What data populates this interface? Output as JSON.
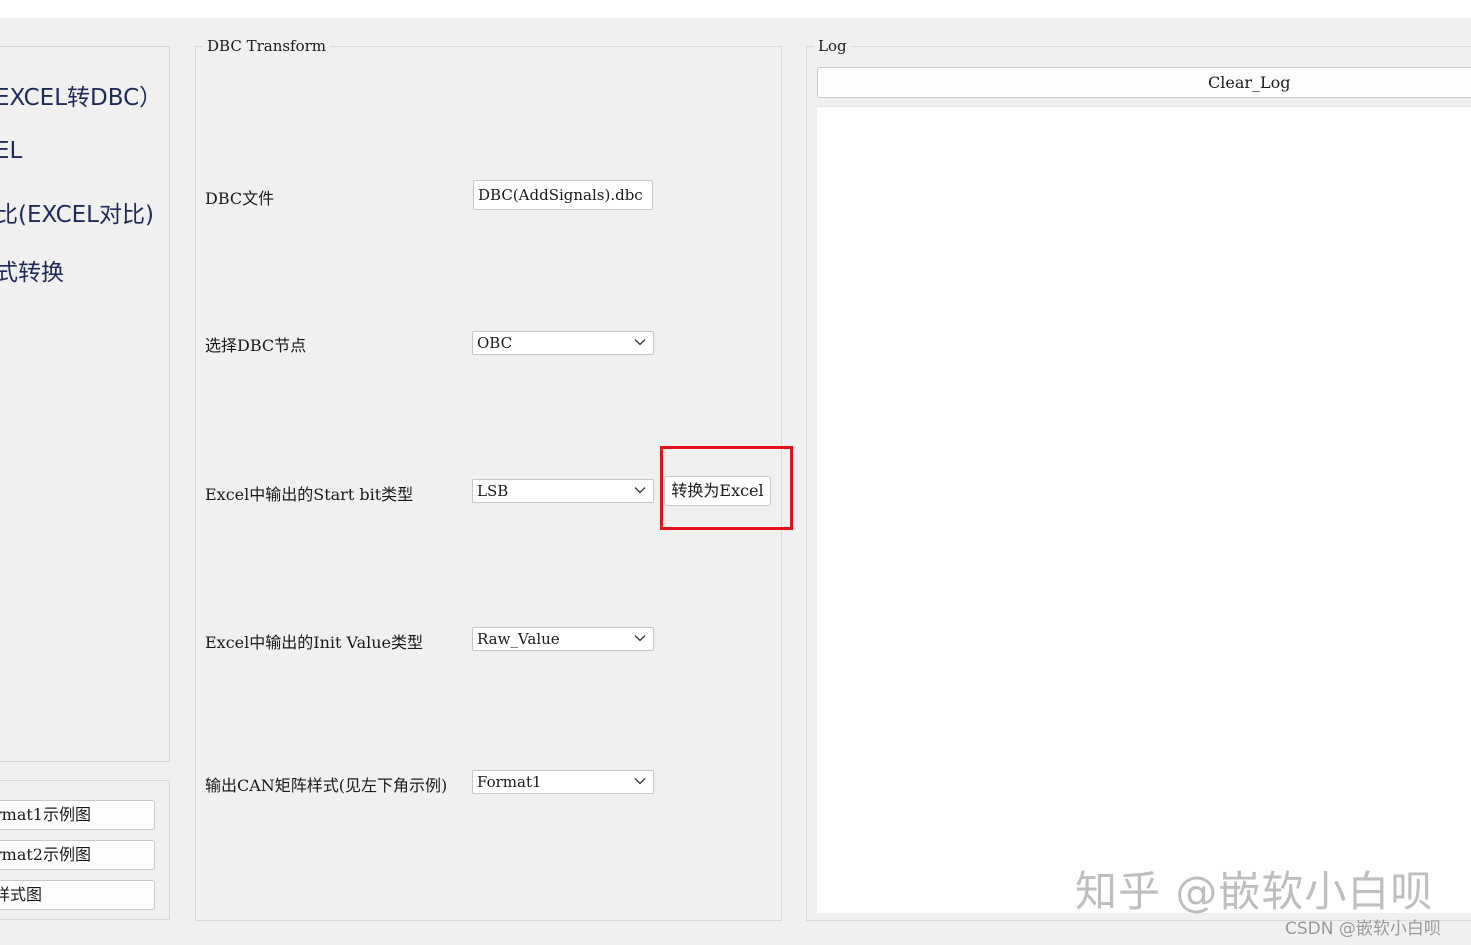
{
  "nav": {
    "items": [
      "EXCEL转DBC）",
      "EL",
      "比(EXCEL对比)",
      "式转换"
    ]
  },
  "format_buttons": [
    "rmat1示例图",
    "rmat2示例图",
    "样式图"
  ],
  "dbc_transform": {
    "title": "DBC Transform",
    "dbc_file_label": "DBC文件",
    "dbc_file_value": "DBC(AddSignals).dbc",
    "node_label": "选择DBC节点",
    "node_value": "OBC",
    "start_bit_label": "Excel中输出的Start bit类型",
    "start_bit_value": "LSB",
    "convert_button": "转换为Excel",
    "init_value_label": "Excel中输出的Init Value类型",
    "init_value_value": "Raw_Value",
    "format_label": "输出CAN矩阵样式(见左下角示例)",
    "format_value": "Format1"
  },
  "log": {
    "title": "Log",
    "clear_button": "Clear_Log"
  },
  "watermark": {
    "main": "知乎 @嵌软小白呗",
    "footer": "CSDN @嵌软小白呗"
  },
  "colors": {
    "highlight": "#e0141a",
    "nav_text": "#1e2a5a",
    "background": "#f0f0f0"
  }
}
